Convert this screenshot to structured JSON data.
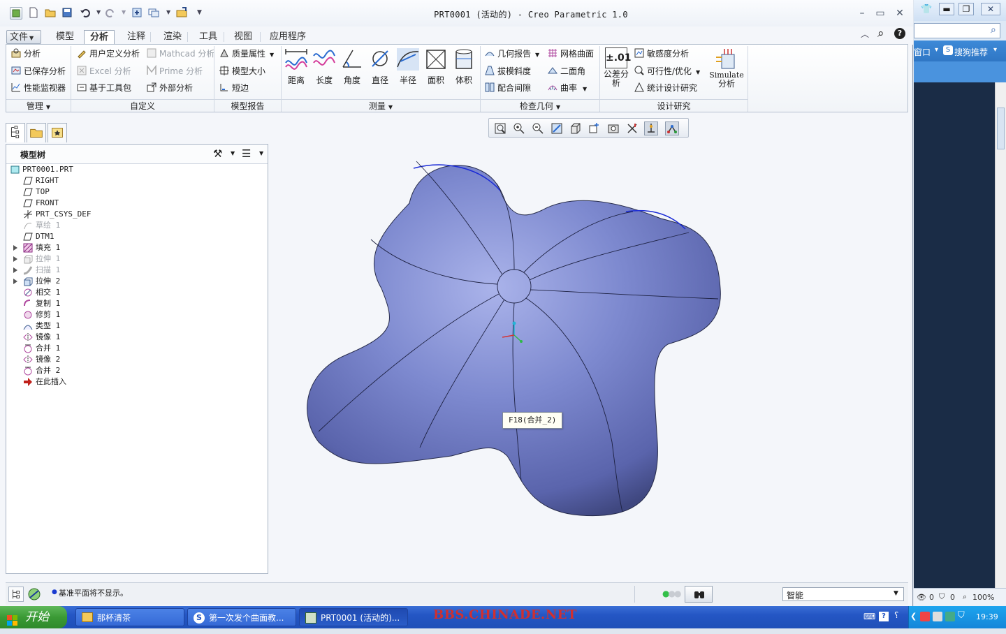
{
  "window": {
    "title": "PRT0001 (活动的) - Creo Parametric 1.0"
  },
  "ribbon_tabs": [
    {
      "label": "文件"
    },
    {
      "label": "模型"
    },
    {
      "label": "分析"
    },
    {
      "label": "注释"
    },
    {
      "label": "渲染"
    },
    {
      "label": "工具"
    },
    {
      "label": "视图"
    },
    {
      "label": "应用程序"
    }
  ],
  "ribbon": {
    "manage": {
      "analysis": "分析",
      "saved_analysis": "已保存分析",
      "perf_monitor": "性能监视器",
      "group": "管理"
    },
    "custom": {
      "user_defined": "用户定义分析",
      "excel": "Excel 分析",
      "toolkit": "基于工具包",
      "mathcad": "Mathcad 分析",
      "prime": "Prime 分析",
      "external": "外部分析",
      "group": "自定义"
    },
    "model_report": {
      "mass_props": "质量属性",
      "model_size": "模型大小",
      "short_edge": "短边",
      "group": "模型报告"
    },
    "measure": {
      "distance": "距离",
      "length": "长度",
      "angle": "角度",
      "diameter": "直径",
      "radius": "半径",
      "area": "面积",
      "volume": "体积",
      "group": "测量"
    },
    "inspect": {
      "geom_report": "几何报告",
      "draft": "拔模斜度",
      "clearance": "配合间隙",
      "mesh_surface": "网格曲面",
      "dihedral": "二面角",
      "curvature": "曲率",
      "group": "检查几何"
    },
    "design_study": {
      "tolerance_icon": "±.01",
      "tolerance": "公差分析",
      "sensitivity": "敏感度分析",
      "feasibility": "可行性/优化",
      "stat_design": "统计设计研究",
      "simulate_1": "Simulate",
      "simulate_2": "分析",
      "group": "设计研究"
    }
  },
  "tree": {
    "title": "模型树",
    "items": [
      {
        "label": "PRT0001.PRT"
      },
      {
        "label": "RIGHT"
      },
      {
        "label": "TOP"
      },
      {
        "label": "FRONT"
      },
      {
        "label": "PRT_CSYS_DEF"
      },
      {
        "label": "草绘 1"
      },
      {
        "label": "DTM1"
      },
      {
        "label": "填充 1"
      },
      {
        "label": "拉伸 1"
      },
      {
        "label": "扫描 1"
      },
      {
        "label": "拉伸 2"
      },
      {
        "label": "相交 1"
      },
      {
        "label": "复制 1"
      },
      {
        "label": "修剪 1"
      },
      {
        "label": "类型 1"
      },
      {
        "label": "镜像 1"
      },
      {
        "label": "合并 1"
      },
      {
        "label": "镜像 2"
      },
      {
        "label": "合并 2"
      },
      {
        "label": "在此插入"
      }
    ]
  },
  "viewport": {
    "tooltip": "F18(合并_2)",
    "model_color": "#7b86cc"
  },
  "status": {
    "message": "基准平面将不显示。",
    "filter_value": "智能"
  },
  "taskbar": {
    "start": "开始",
    "tasks": [
      {
        "label": "那杯清茶"
      },
      {
        "label": "第一次发个曲面教..."
      },
      {
        "label": "PRT0001 (活动的)..."
      }
    ],
    "watermark": "BBS.CHINADE.NET",
    "clock": "19:39"
  },
  "right_window": {
    "menu_1": "窗口",
    "menu_2": "搜狗推荐",
    "zoom": "100%",
    "count_1": "0",
    "count_2": "0"
  }
}
